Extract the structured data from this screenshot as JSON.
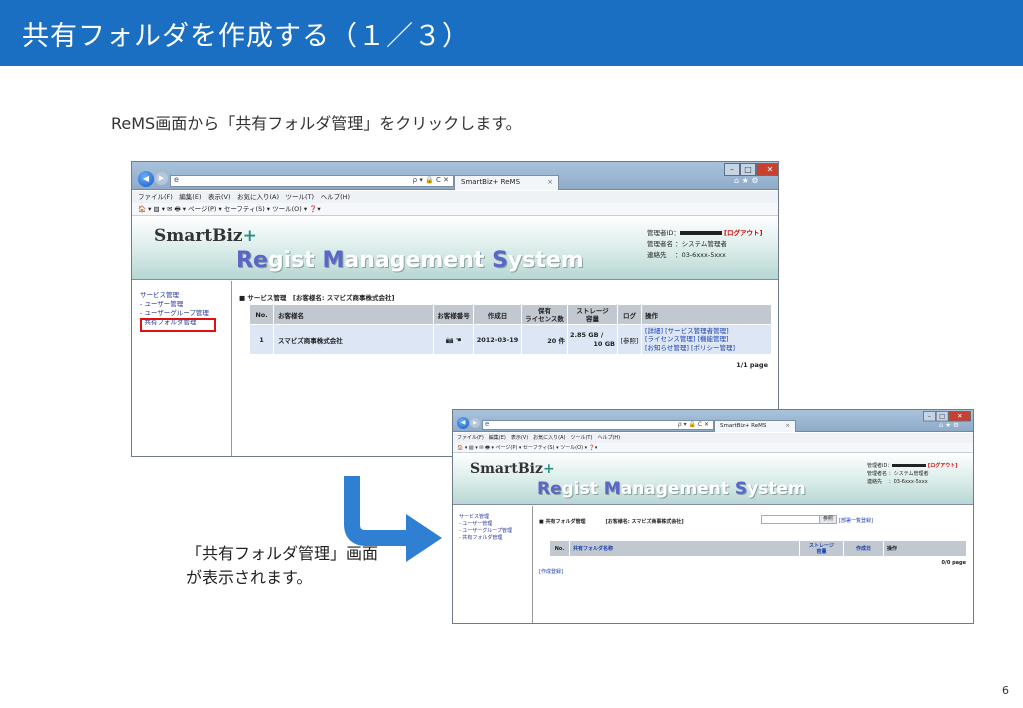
{
  "slide": {
    "title": "共有フォルダを作成する（１／３）",
    "intro": "ReMS画面から「共有フォルダ管理」をクリックします。",
    "caption_line1": "「共有フォルダ管理」画面",
    "caption_line2": "が表示されます。",
    "page_number": "6"
  },
  "browser": {
    "url_search": "ρ ▾ 🔒 C ✕",
    "tab_label": "SmartBiz+ ReMS",
    "tab_close": "×",
    "toolbar_icons": "⌂ ★ ⚙",
    "window_buttons": {
      "minimize": "–",
      "maximize": "□",
      "close": "✕"
    },
    "menu": "ファイル(F)　編集(E)　表示(V)　お気に入り(A)　ツール(T)　ヘルプ(H)",
    "commands": "🏠 ▾ ▧ ▾ ✉ 🖶 ▾ ページ(P) ▾ セーフティ(S) ▾ ツール(O) ▾ ❓▾",
    "back_icon": "◀",
    "forward_icon": "▶",
    "favicon": "e"
  },
  "app": {
    "logo_text": "SmartBiz",
    "logo_plus": "+",
    "system_name": {
      "r_acc": "Re",
      "r_rest": "gist ",
      "m_acc": "M",
      "m_rest": "anagement ",
      "s_acc": "S",
      "s_rest": "ystem"
    },
    "admin_id_label": "管理者ID：",
    "logout": "[ログアウト]",
    "admin_name": "管理者名 ：システム管理者",
    "contact": "連絡先　 ：03-6xxx-5xxx"
  },
  "sidebar": {
    "items": [
      "サービス管理",
      "- ユーザー管理",
      "- ユーザーグループ管理",
      "- 共有フォルダ管理"
    ]
  },
  "screen1": {
    "section_title": "■ サービス管理　[お客様名: スマビズ商事株式会社]",
    "columns": [
      "No.",
      "お客様名",
      "お客様番号",
      "作成日",
      "保有\nライセンス数",
      "ストレージ\n容量",
      "ログ",
      "操作"
    ],
    "row": {
      "no": "1",
      "customer": "スマビズ商事株式会社",
      "number_icon": "📷 ☚",
      "created": "2012-03-19",
      "licenses": "20 件",
      "storage_used": "2.85 GB /",
      "storage_total": "10 GB",
      "log": "[参照]",
      "actions_1": "[詳細] [サービス管理者管理]",
      "actions_2": "[ライセンス管理] [機能管理]",
      "actions_3": "[お知らせ管理] [ポリシー管理]"
    },
    "pager": "1/1 page"
  },
  "screen2": {
    "section_title": "■ 共有フォルダ管理　　　　[お客様名: スマビズ商事株式会社]",
    "button_ref": "参照",
    "link_dept": "[部署一覧登録]",
    "columns": [
      "No.",
      "共有フォルダ名称",
      "ストレージ\n容量",
      "作成日",
      "操作"
    ],
    "pager": "0/0 page",
    "create_link": "[作成登録]"
  },
  "colors": {
    "header_blue": "#1a6fc3",
    "arrow_blue": "#2f7fd3",
    "highlight_red": "#e01010"
  }
}
